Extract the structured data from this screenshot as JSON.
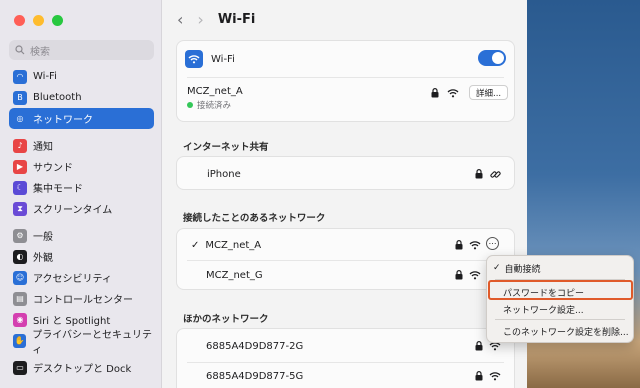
{
  "window": {
    "title": "Wi-Fi"
  },
  "search": {
    "placeholder": "検索"
  },
  "sidebar": {
    "groups": [
      [
        {
          "label": "Wi-Fi",
          "icon": "wifi-icon",
          "color": "#2a6fd6",
          "active": false
        },
        {
          "label": "Bluetooth",
          "icon": "bluetooth-icon",
          "color": "#2a6fd6",
          "active": false
        },
        {
          "label": "ネットワーク",
          "icon": "globe-icon",
          "color": "#2a6fd6",
          "active": true
        }
      ],
      [
        {
          "label": "通知",
          "icon": "bell-icon",
          "color": "#e84545",
          "active": false
        },
        {
          "label": "サウンド",
          "icon": "speaker-icon",
          "color": "#e84545",
          "active": false
        },
        {
          "label": "集中モード",
          "icon": "moon-icon",
          "color": "#5b4bd6",
          "active": false
        },
        {
          "label": "スクリーンタイム",
          "icon": "hourglass-icon",
          "color": "#6a4bd6",
          "active": false
        }
      ],
      [
        {
          "label": "一般",
          "icon": "gear-icon",
          "color": "#8e8e93",
          "active": false
        },
        {
          "label": "外観",
          "icon": "appearance-icon",
          "color": "#1d1d1f",
          "active": false
        },
        {
          "label": "アクセシビリティ",
          "icon": "accessibility-icon",
          "color": "#2a6fd6",
          "active": false
        },
        {
          "label": "コントロールセンター",
          "icon": "control-center-icon",
          "color": "#8e8e93",
          "active": false
        },
        {
          "label": "Siri と Spotlight",
          "icon": "siri-icon",
          "color": "#d43fb0",
          "active": false
        },
        {
          "label": "プライバシーとセキュリティ",
          "icon": "hand-icon",
          "color": "#2a6fd6",
          "active": false
        }
      ],
      [
        {
          "label": "デスクトップと Dock",
          "icon": "desktop-icon",
          "color": "#1d1d1f",
          "active": false
        }
      ]
    ]
  },
  "wifi": {
    "label": "Wi-Fi",
    "toggle_on": true,
    "connected_name": "MCZ_net_A",
    "connected_status": "接続済み",
    "details_button": "詳細..."
  },
  "hotspot": {
    "section_title": "インターネット共有",
    "device": "iPhone"
  },
  "known": {
    "section_title": "接続したことのあるネットワーク",
    "networks": [
      "MCZ_net_A",
      "MCZ_net_G"
    ]
  },
  "other": {
    "section_title": "ほかのネットワーク",
    "networks": [
      "6885A4D9D877-2G",
      "6885A4D9D877-5G"
    ]
  },
  "context_menu": {
    "auto_join": "自動接続",
    "copy_password": "パスワードをコピー",
    "network_settings": "ネットワーク設定...",
    "remove": "このネットワーク設定を削除..."
  },
  "colors": {
    "accent": "#2a6fd6",
    "highlight": "#e05a2a",
    "connected_dot": "#34c759"
  }
}
